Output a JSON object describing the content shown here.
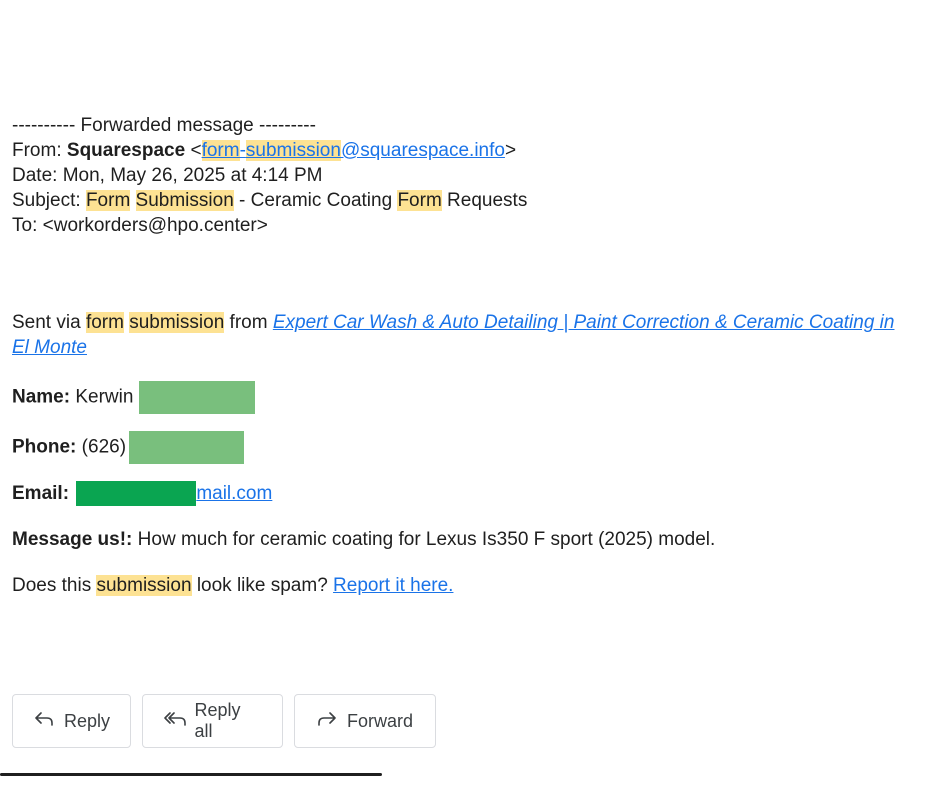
{
  "forwarded": {
    "divider": "---------- Forwarded message ---------",
    "from_label": "From:",
    "from_name": "Squarespace",
    "from_email_lt": "<",
    "from_email_part1": "form",
    "from_email_dash": "-",
    "from_email_part2": "submission",
    "from_email_rest": "@squarespace.info",
    "from_email_gt": ">",
    "date_line": "Date: Mon, May 26, 2025 at 4:14 PM",
    "subject_label": "Subject:",
    "subject_w1": "Form",
    "subject_w2": "Submission",
    "subject_mid": "- Ceramic Coating",
    "subject_w3": "Form",
    "subject_end": "Requests",
    "to_line": "To: <workorders@hpo.center>"
  },
  "message": {
    "sent_prefix": "Sent via",
    "sent_w1": "form",
    "sent_w2": "submission",
    "sent_from": "from",
    "site_link": "Expert Car Wash & Auto Detailing | Paint Correction & Ceramic Coating in El Monte",
    "name_label": "Name:",
    "name_value": "Kerwin",
    "phone_label": "Phone:",
    "phone_value": "(626)",
    "email_label": "Email:",
    "email_value": "mail.com",
    "msg_label": "Message us!:",
    "msg_value": "How much for ceramic coating for Lexus Is350 F sport (2025) model.",
    "spam_prefix": "Does this",
    "spam_word": "submission",
    "spam_suffix": "look like spam?",
    "report_link": "Report it here."
  },
  "actions": {
    "reply": "Reply",
    "reply_all": "Reply all",
    "forward": "Forward"
  },
  "colors": {
    "highlight": "#fde293",
    "link": "#1a73e8",
    "redaction_light": "#79bf7d",
    "redaction_dark": "#0aa551"
  }
}
